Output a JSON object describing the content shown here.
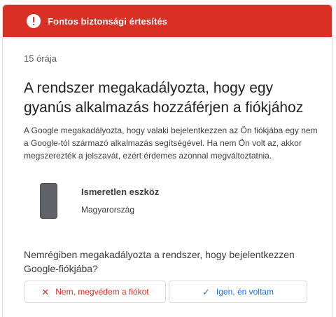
{
  "banner": {
    "icon": "alert-circle-icon",
    "title": "Fontos biztonsági értesítés",
    "color": "#d93025"
  },
  "notification": {
    "time": "15 órája",
    "headline": "A rendszer megakadályozta, hogy egy gyanús alkalmazás hozzáférjen a fiókjához",
    "body": "A Google megakadályozta, hogy valaki bejelentkezzen az Ön fiókjába egy nem a Google-tól származó alkalmazás segítségével. Ha nem Ön volt az, akkor megszerezték a jelszavát, ezért érdemes azonnal megváltoztatnia."
  },
  "device": {
    "icon": "phone-icon",
    "name": "Ismeretlen eszköz",
    "location": "Magyarország"
  },
  "prompt": {
    "question": "Nemrégiben megakadályozta a rendszer, hogy bejelentkezzen Google-fiókjába?"
  },
  "actions": {
    "no": {
      "icon": "close-icon",
      "label": "Nem, megvédem a fiókot",
      "color": "#d93025"
    },
    "yes": {
      "icon": "check-icon",
      "label": "Igen, én voltam",
      "color": "#1a73e8"
    }
  }
}
